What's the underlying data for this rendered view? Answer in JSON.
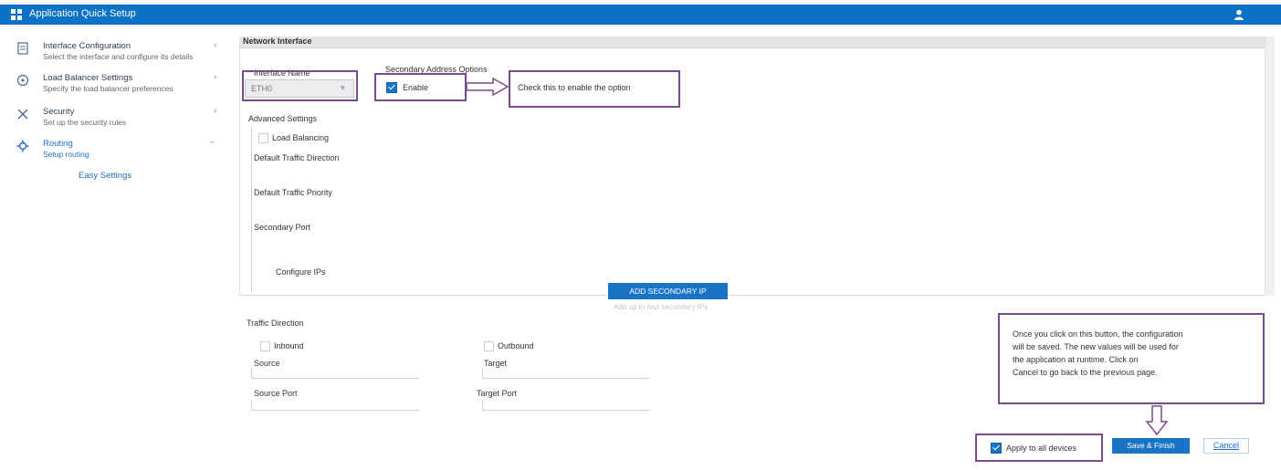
{
  "app": {
    "title": "Application Quick Setup",
    "logo_icon": "grid-icon",
    "user_icon": "user-icon",
    "brand_color": "#0b72c6"
  },
  "sidebar": {
    "items": [
      {
        "title": "Interface Configuration",
        "desc": "Select the interface and configure its details",
        "icon": "document-icon"
      },
      {
        "title": "Load Balancer Settings",
        "desc": "Specify the load balancer preferences",
        "icon": "circle-icon"
      },
      {
        "title": "Security",
        "desc": "Set up the security rules",
        "icon": "tools-icon"
      },
      {
        "title": "Routing",
        "desc": "Setup routing",
        "icon": "gear-icon"
      }
    ],
    "active_sub": "Easy Settings"
  },
  "panel": {
    "title": "Network Interface",
    "interface": {
      "label": "Interface Name",
      "value": "ETH0"
    },
    "option": {
      "group_label": "Secondary Address Options",
      "checkbox_label": "Enable",
      "checked": true
    },
    "advanced": {
      "label": "Advanced Settings",
      "toggle_label": "Load Balancing",
      "fields": [
        "Default Traffic Direction",
        "Default Traffic Priority",
        "Secondary Port"
      ],
      "sub_item": "Configure IPs"
    },
    "add_button": "ADD SECONDARY IP",
    "add_hint": "Add up to four secondary IPs"
  },
  "traffic": {
    "label": "Traffic Direction",
    "left": {
      "heading": "Inbound",
      "field1": "Source",
      "field2": "Source Port"
    },
    "right": {
      "heading": "Outbound",
      "field1": "Target",
      "field2": "Target Port"
    }
  },
  "callouts": {
    "checkbox": "Check this to enable the option",
    "save": [
      "Once you click on this button, the configuration",
      "will be saved. The new values will be used for",
      "the application at runtime. Click on",
      "Cancel to go back to the previous page."
    ]
  },
  "footer": {
    "checkbox_label": "Apply to all devices",
    "checked": true,
    "save_button": "Save & Finish",
    "cancel_link": "Cancel"
  },
  "colors": {
    "annotation": "#7a4a8c",
    "accent": "#1a74c6",
    "link": "#1b6fc2"
  }
}
